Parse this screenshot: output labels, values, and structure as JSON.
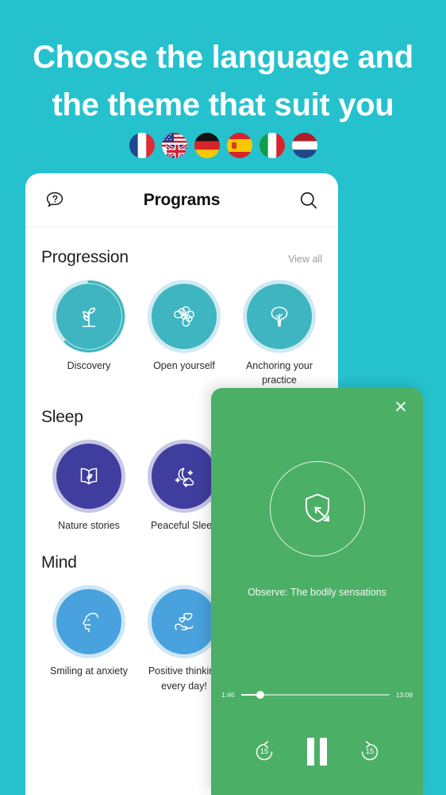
{
  "promo": {
    "headline_line1": "Choose the language and",
    "headline_line2": "the theme that suit you",
    "background_color": "#25c2ce",
    "flags": [
      {
        "name": "flag-france",
        "label": "France"
      },
      {
        "name": "flag-united-states-united-kingdom",
        "label": "English"
      },
      {
        "name": "flag-germany",
        "label": "Germany"
      },
      {
        "name": "flag-spain",
        "label": "Spain"
      },
      {
        "name": "flag-italy",
        "label": "Italy"
      },
      {
        "name": "flag-netherlands",
        "label": "Netherlands"
      }
    ]
  },
  "app": {
    "header": {
      "help_icon": "question-bubble-icon",
      "title": "Programs",
      "search_icon": "search-icon"
    },
    "sections": [
      {
        "title": "Progression",
        "view_all": "View all",
        "theme": "teal",
        "accent": "#3eb5c0",
        "items": [
          {
            "label": "Discovery",
            "icon": "sprout-icon",
            "progress": 0.62
          },
          {
            "label": "Open yourself",
            "icon": "flower-mandala-icon",
            "progress": 0
          },
          {
            "label": "Anchoring your practice",
            "icon": "tree-icon",
            "progress": 0
          },
          {
            "label": "",
            "icon": "partial-tile-icon",
            "progress": 0
          }
        ]
      },
      {
        "title": "Sleep",
        "view_all": "",
        "theme": "purple",
        "accent": "#3f3d9e",
        "items": [
          {
            "label": "Nature stories",
            "icon": "book-leaf-icon",
            "progress": 0
          },
          {
            "label": "Peaceful Sleep",
            "icon": "moon-stars-icon",
            "progress": 0
          }
        ]
      },
      {
        "title": "Mind",
        "view_all": "",
        "theme": "blue",
        "accent": "#49a2dd",
        "items": [
          {
            "label": "Smiling at anxiety",
            "icon": "head-profile-icon",
            "progress": 0
          },
          {
            "label": "Positive thinking every day!",
            "icon": "hand-hearts-icon",
            "progress": 0
          }
        ]
      }
    ]
  },
  "player": {
    "background_color": "#4caf66",
    "close_icon": "close-icon",
    "artwork_icon": "shield-arrow-icon",
    "caption": "Observe: The bodily sensations",
    "elapsed": "1:46",
    "duration": "13:08",
    "progress_percent": 13,
    "rewind_label": "15",
    "forward_label": "15",
    "rewind_icon": "replay-15-icon",
    "play_state_icon": "pause-icon",
    "forward_icon": "forward-15-icon"
  }
}
